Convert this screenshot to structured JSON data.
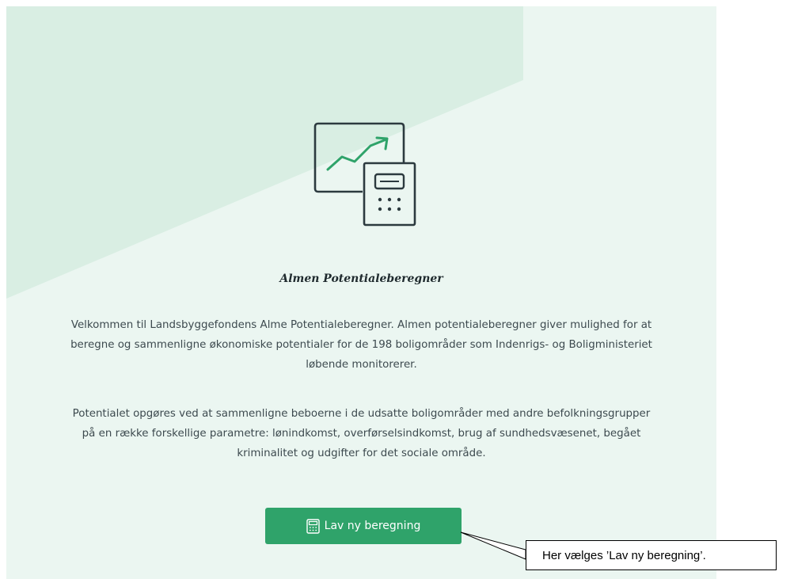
{
  "app": {
    "title": "Almen Potentialeberegner",
    "paragraphs": {
      "intro": "Velkommen til Landsbyggefondens Alme Potentialeberegner. Almen potentialeberegner giver mulighed for at beregne og sammenligne økonomiske potentialer for de 198 boligområder som Indenrigs- og Boligministeriet løbende monitorerer.",
      "details": "Potentialet opgøres ved at sammenligne beboerne i de udsatte boligområder med andre befolkningsgrupper på en række forskellige parametre: lønindkomst, overførselsindkomst, brug af sundhedsvæsenet, begået kriminalitet og udgifter for det sociale område."
    },
    "actions": {
      "new_calculation_label": "Lav ny beregning",
      "new_calculation_icon": "calculator-icon"
    },
    "hero_icon": "chart-calculator-icon"
  },
  "annotation": {
    "callout_text": "Her vælges ’Lav ny beregning’."
  },
  "colors": {
    "panel_bg": "#ebf6f1",
    "panel_shape": "#d9eee3",
    "accent": "#2fa36a",
    "icon_stroke": "#2c3a3f",
    "text": "#3d4a4f"
  }
}
